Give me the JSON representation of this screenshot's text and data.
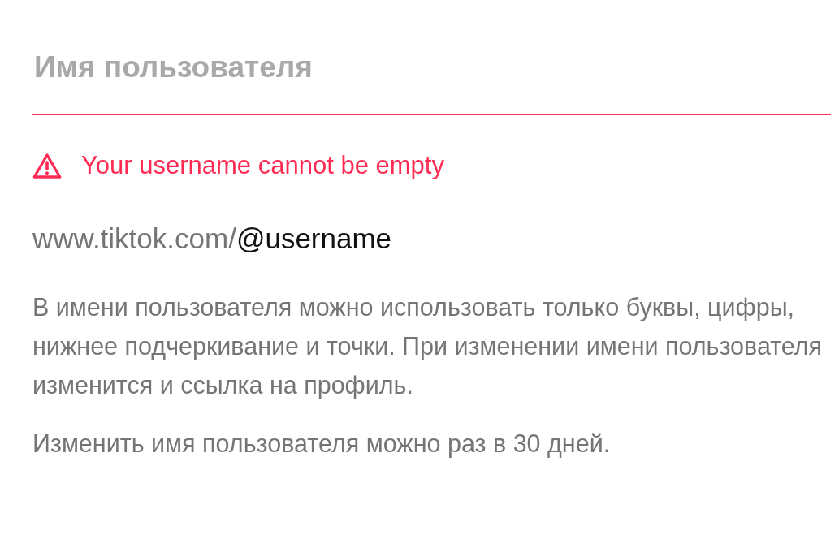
{
  "username_field": {
    "placeholder": "Имя пользователя",
    "error": true
  },
  "error_message": {
    "text": "Your username cannot be empty"
  },
  "profile_link": {
    "prefix": "www.tiktok.com/",
    "username": "@username"
  },
  "hints": [
    "В имени пользователя можно использовать только буквы, цифры, нижнее подчеркивание и точки. При изменении имени пользователя изменится и ссылка на профиль.",
    "Изменить имя пользователя можно раз в 30 дней."
  ]
}
